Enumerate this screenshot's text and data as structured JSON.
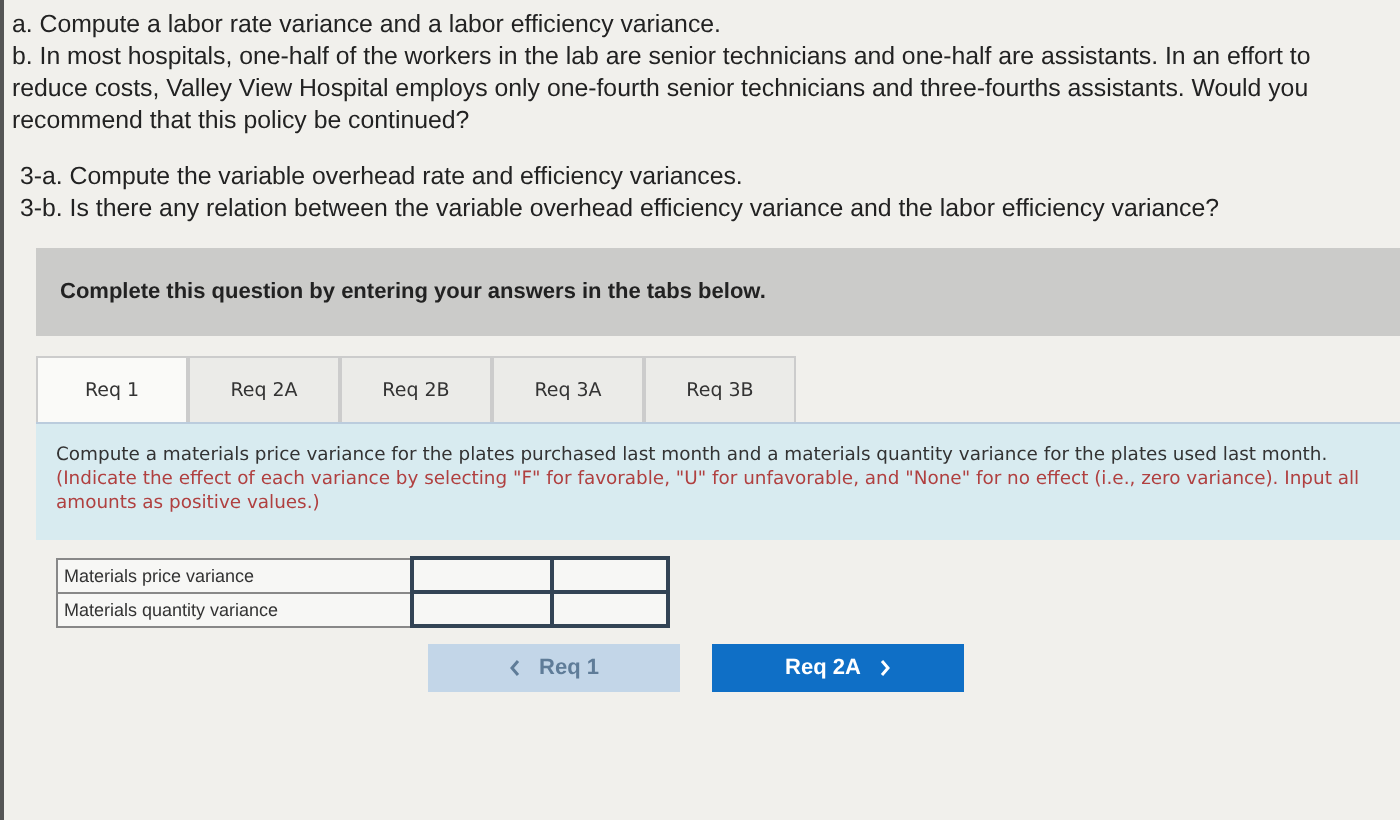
{
  "questions": [
    {
      "text": "a. Compute a labor rate variance and a labor efficiency variance."
    },
    {
      "text": "b. In most hospitals, one-half of the workers in the lab are senior technicians and one-half are assistants. In an effort to reduce costs, Valley View Hospital employs only one-fourth senior technicians and three-fourths assistants. Would you recommend that this policy be continued?"
    }
  ],
  "requirements": [
    {
      "text": "3-a. Compute the variable overhead rate and efficiency variances."
    },
    {
      "text": "3-b. Is there any relation between the variable overhead efficiency variance and the labor efficiency variance?"
    }
  ],
  "banner": "Complete this question by entering your answers in the tabs below.",
  "tabs": [
    {
      "label": "Req 1",
      "selected": true
    },
    {
      "label": "Req 2A",
      "selected": false
    },
    {
      "label": "Req 2B",
      "selected": false
    },
    {
      "label": "Req 3A",
      "selected": false
    },
    {
      "label": "Req 3B",
      "selected": false
    }
  ],
  "instruction": {
    "text": "Compute a materials price variance for the plates purchased last month and a materials quantity variance for the plates used last month.",
    "note": "(Indicate the effect of each variance by selecting \"F\" for favorable, \"U\" for unfavorable, and \"None\" for no effect (i.e., zero variance). Input all amounts as positive values.)"
  },
  "table": {
    "rows": [
      {
        "label": "Materials price variance"
      },
      {
        "label": "Materials quantity variance"
      }
    ]
  },
  "nav_buttons": [
    {
      "kind": "prev",
      "label": "Req 1",
      "disabled": true
    },
    {
      "kind": "next",
      "label": "Req 2A",
      "disabled": false
    }
  ]
}
